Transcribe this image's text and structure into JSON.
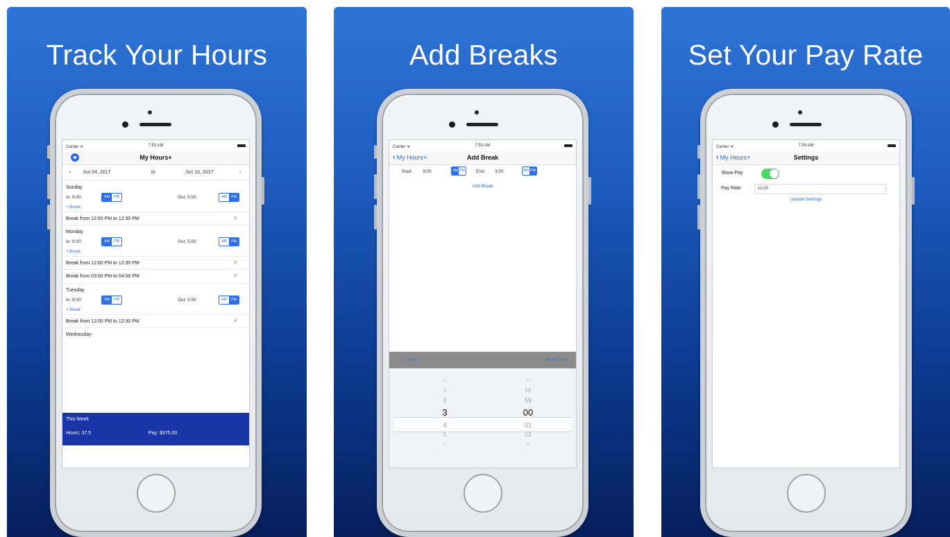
{
  "panels": [
    {
      "title": "Track Your Hours",
      "status": {
        "carrier": "Carrier ᯤ",
        "time": "7:53 AM"
      },
      "nav": {
        "title": "My Hours+"
      },
      "date_range": {
        "prev": "‹",
        "start": "Jun 04, 2017",
        "sep": "to",
        "end": "Jun 10, 2017",
        "next": "›"
      },
      "days": [
        {
          "name": "Sunday",
          "in": "In:  9:00",
          "out": "Out:  5:00",
          "add_break": "+ Break",
          "breaks": [
            "Break from 12:00 PM to 12:30 PM"
          ]
        },
        {
          "name": "Monday",
          "in": "In:  9:00",
          "out": "Out:  5:00",
          "add_break": "+ Break",
          "breaks": [
            "Break from 12:00 PM to 12:30 PM",
            "Break from 03:00 PM to 04:00 PM"
          ]
        },
        {
          "name": "Tuesday",
          "in": "In:  9:00",
          "out": "Out:  5:00",
          "add_break": "+ Break",
          "breaks": [
            "Break from 12:00 PM to 12:30 PM"
          ]
        },
        {
          "name": "Wednesday"
        }
      ],
      "ampm": {
        "am": "AM",
        "pm": "PM"
      },
      "delete_glyph": "x",
      "summary": {
        "label": "This Week",
        "hours": "Hours: 37.5",
        "pay": "Pay: $375.00"
      }
    },
    {
      "title": "Add Breaks",
      "status": {
        "carrier": "Carrier ᯤ",
        "time": "7:53 AM"
      },
      "nav": {
        "back": "My Hours+",
        "title": "Add Break"
      },
      "time_row": {
        "start_label": "Start:",
        "start_value": "3:00",
        "end_label": "End:",
        "end_value": "3:00"
      },
      "ampm": {
        "am": "AM",
        "pm": "PM"
      },
      "add_break": "Add Break",
      "toolbar": {
        "left": "Done",
        "right": "Select Time"
      },
      "picker": {
        "hours": [
          "12",
          "1",
          "2",
          "3",
          "4",
          "5",
          "6"
        ],
        "minutes": [
          "57",
          "58",
          "59",
          "00",
          "01",
          "02",
          "03"
        ]
      }
    },
    {
      "title": "Set Your Pay Rate",
      "status": {
        "carrier": "Carrier ᯤ",
        "time": "7:54 AM"
      },
      "nav": {
        "back": "My Hours+",
        "title": "Settings"
      },
      "show_pay_label": "Show Pay",
      "pay_rate_label": "Pay Rate",
      "pay_rate_value": "10.00",
      "update_button": "Update Settings"
    }
  ]
}
